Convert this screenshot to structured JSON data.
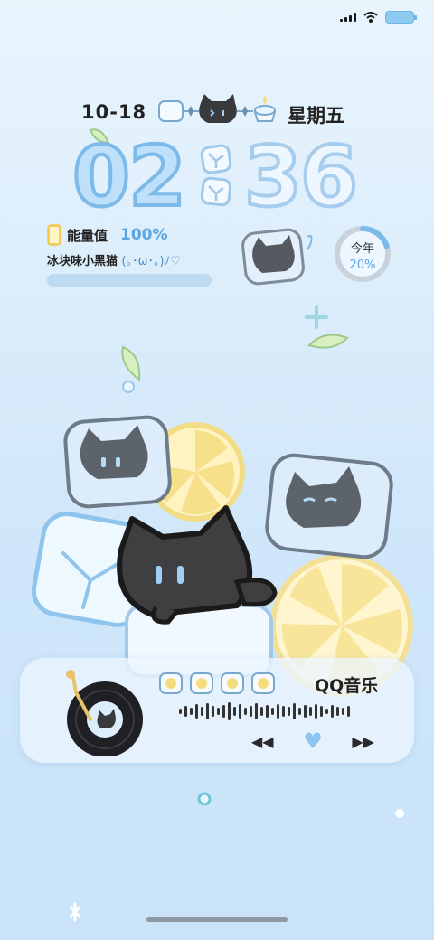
{
  "status_bar": {
    "signal_icon": "cellular-signal-icon",
    "wifi_icon": "wifi-icon",
    "battery_icon": "battery-icon",
    "battery_color": "#8ec9f0"
  },
  "date": {
    "date": "10-18",
    "weekday": "星期五"
  },
  "clock": {
    "hours": "02",
    "minutes": "36"
  },
  "energy": {
    "label": "能量值",
    "value": "100%",
    "level": 1.0,
    "icon": "phone-battery-icon"
  },
  "cat_name": {
    "text": "冰块味小黑猫",
    "kaomoji": "(｡･ω･｡)ﾉ♡"
  },
  "year_progress": {
    "label": "今年",
    "value": "20%",
    "level": 0.2
  },
  "music": {
    "app_name": "QQ音乐",
    "prev_label": "◀◀",
    "next_label": "▶▶",
    "like_icon": "heart-icon"
  },
  "footer": {
    "text": "Ice cube little black cat"
  },
  "colors": {
    "accent": "#5aa6e2",
    "clock_stroke": "#7cbaea",
    "lemon": "#f6dd7c",
    "cat": "#4a4a4a"
  }
}
